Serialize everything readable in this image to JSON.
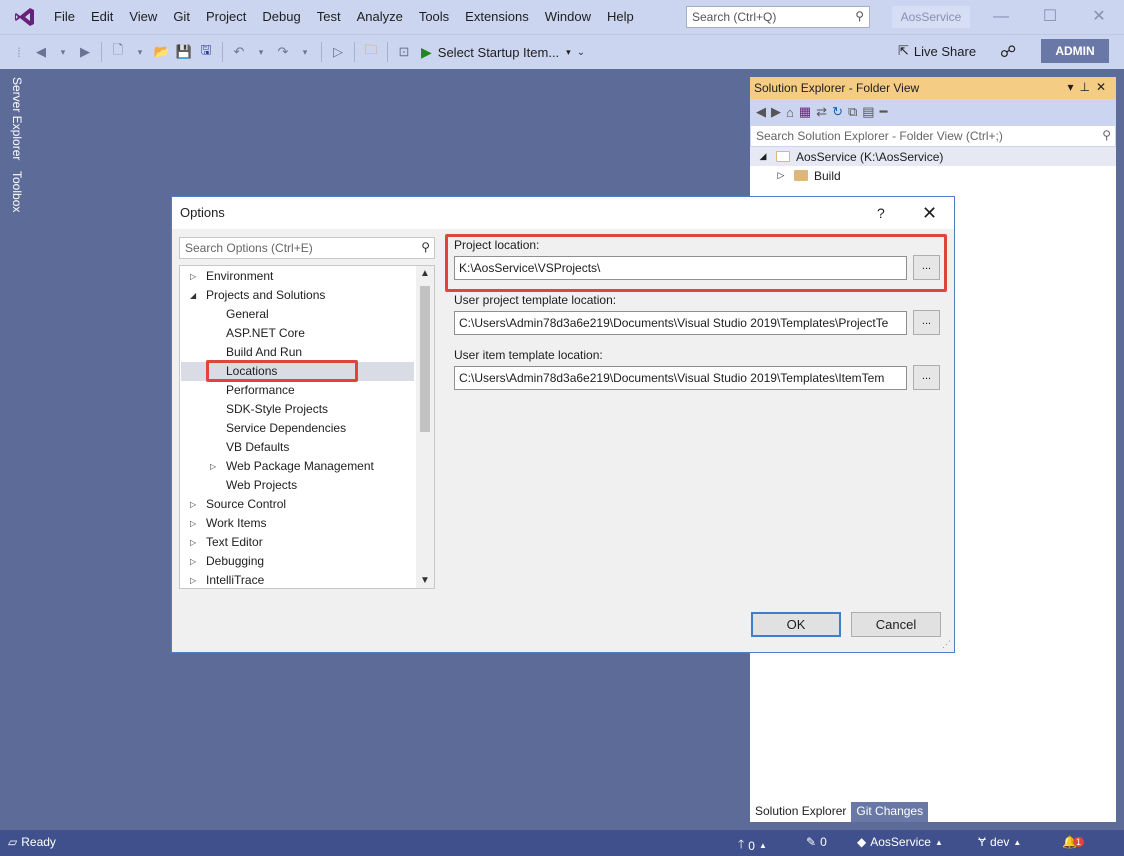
{
  "menu": [
    "File",
    "Edit",
    "View",
    "Git",
    "Project",
    "Debug",
    "Test",
    "Analyze",
    "Tools",
    "Extensions",
    "Window",
    "Help"
  ],
  "search": {
    "placeholder": "Search (Ctrl+Q)"
  },
  "solution_badge": "AosService",
  "toolbar": {
    "startup_label": "Select Startup Item...",
    "live_share": "Live Share",
    "account": "ADMIN"
  },
  "side_tabs": [
    "Server Explorer",
    "Toolbox"
  ],
  "solution_explorer": {
    "title": "Solution Explorer - Folder View",
    "search_placeholder": "Search Solution Explorer - Folder View (Ctrl+;)",
    "tree": [
      {
        "label": "AosService (K:\\AosService)",
        "expanded": true
      },
      {
        "label": "Build",
        "expanded": false
      }
    ],
    "tabs": [
      "Solution Explorer",
      "Git Changes"
    ]
  },
  "dialog": {
    "title": "Options",
    "help": "?",
    "search_placeholder": "Search Options (Ctrl+E)",
    "tree": [
      {
        "label": "Environment",
        "level": 0,
        "arrow": "collapsed"
      },
      {
        "label": "Projects and Solutions",
        "level": 0,
        "arrow": "expanded"
      },
      {
        "label": "General",
        "level": 1,
        "arrow": ""
      },
      {
        "label": "ASP.NET Core",
        "level": 1,
        "arrow": ""
      },
      {
        "label": "Build And Run",
        "level": 1,
        "arrow": ""
      },
      {
        "label": "Locations",
        "level": 1,
        "arrow": "",
        "selected": true
      },
      {
        "label": "Performance",
        "level": 1,
        "arrow": ""
      },
      {
        "label": "SDK-Style Projects",
        "level": 1,
        "arrow": ""
      },
      {
        "label": "Service Dependencies",
        "level": 1,
        "arrow": ""
      },
      {
        "label": "VB Defaults",
        "level": 1,
        "arrow": ""
      },
      {
        "label": "Web Package Management",
        "level": 1,
        "arrow": "collapsed"
      },
      {
        "label": "Web Projects",
        "level": 1,
        "arrow": ""
      },
      {
        "label": "Source Control",
        "level": 0,
        "arrow": "collapsed"
      },
      {
        "label": "Work Items",
        "level": 0,
        "arrow": "collapsed"
      },
      {
        "label": "Text Editor",
        "level": 0,
        "arrow": "collapsed"
      },
      {
        "label": "Debugging",
        "level": 0,
        "arrow": "collapsed"
      },
      {
        "label": "IntelliTrace",
        "level": 0,
        "arrow": "collapsed"
      }
    ],
    "fields": [
      {
        "label": "Project location:",
        "value": "K:\\AosService\\VSProjects\\"
      },
      {
        "label": "User project template location:",
        "value": "C:\\Users\\Admin78d3a6e219\\Documents\\Visual Studio 2019\\Templates\\ProjectTe"
      },
      {
        "label": "User item template location:",
        "value": "C:\\Users\\Admin78d3a6e219\\Documents\\Visual Studio 2019\\Templates\\ItemTem"
      }
    ],
    "browse_label": "...",
    "ok": "OK",
    "cancel": "Cancel"
  },
  "status": {
    "ready": "Ready",
    "pushes": "0",
    "edits": "0",
    "repo": "AosService",
    "branch": "dev",
    "notifications": "1"
  },
  "colors": {
    "highlight": "#e0453c",
    "accent": "#f5cc84",
    "status_bg": "#40508d"
  }
}
